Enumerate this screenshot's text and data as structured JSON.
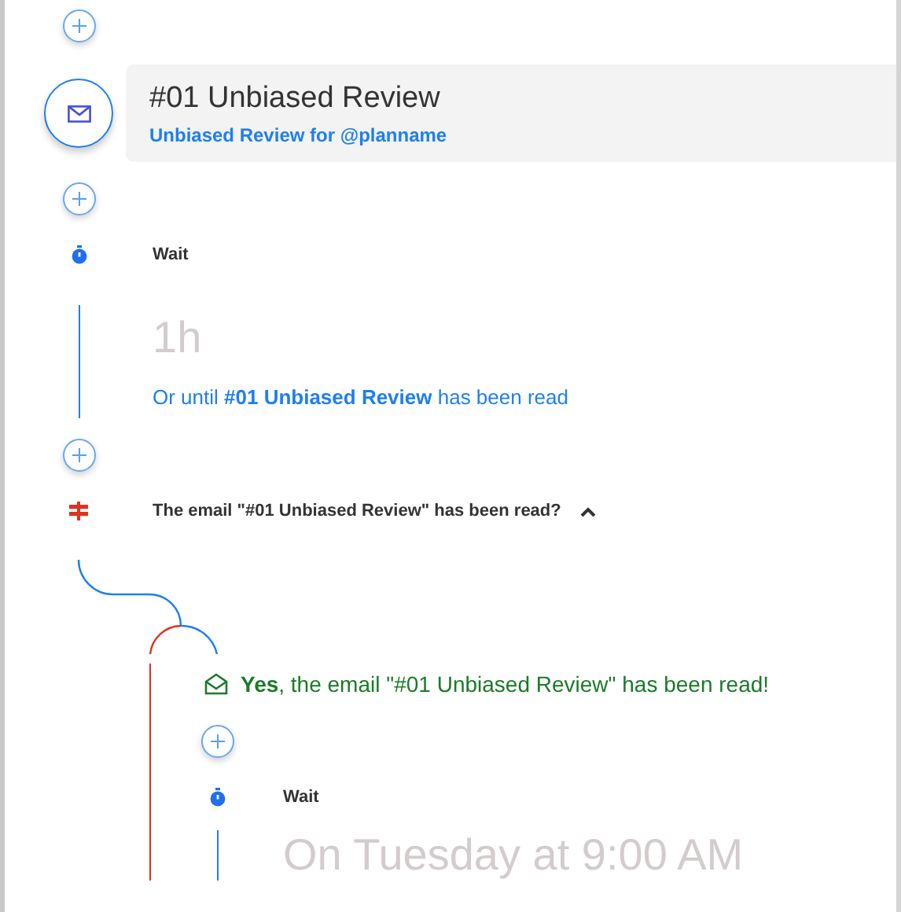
{
  "steps": [
    {
      "kind": "add"
    },
    {
      "kind": "email",
      "title": "#01 Unbiased Review",
      "subtitle": "Unbiased Review for @planname"
    },
    {
      "kind": "add"
    },
    {
      "kind": "wait",
      "label": "Wait",
      "duration": "1h",
      "condition": "Or until **#01 Unbiased Review** has been read"
    },
    {
      "kind": "add"
    },
    {
      "kind": "condition",
      "label": "The email \"#01 Unbiased Review\" has been read?",
      "expanded": true,
      "branch": {
        "label": "**Yes**, the email \"#01 Unbiased Review\" has been read!",
        "steps": [
          {
            "kind": "add"
          },
          {
            "kind": "wait",
            "label": "Wait",
            "duration": "On Tuesday at 9:00 AM"
          }
        ]
      }
    }
  ]
}
